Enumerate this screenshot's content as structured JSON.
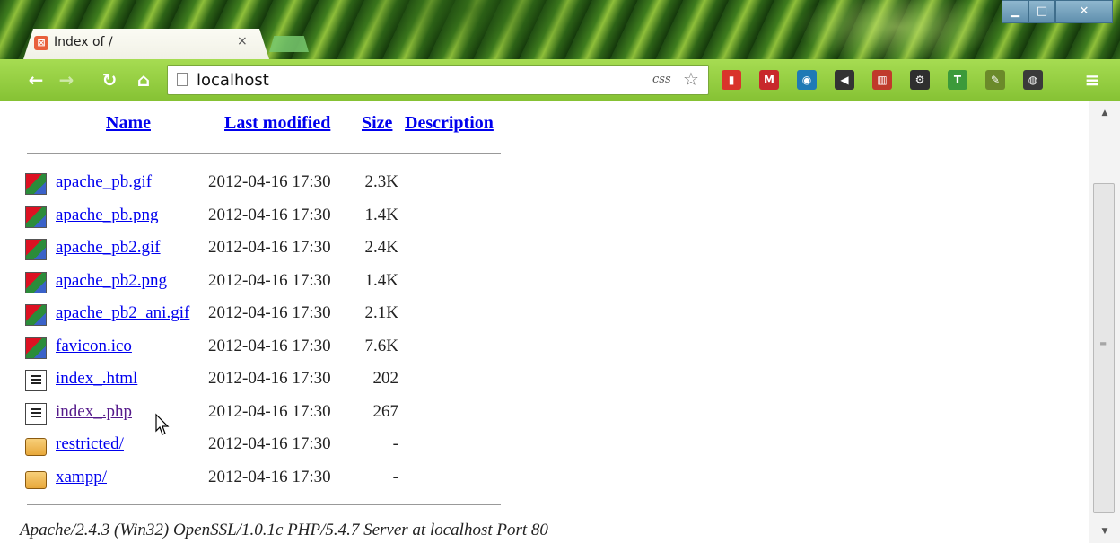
{
  "browser": {
    "tab": {
      "favicon": "xampp-favicon",
      "title": "Index of /",
      "close_label": "×"
    },
    "window_controls": {
      "minimize": "▁",
      "maximize": "□",
      "close": "✕"
    },
    "toolbar": {
      "back_icon": "back-arrow-icon",
      "forward_icon": "forward-arrow-icon",
      "reload_icon": "reload-icon",
      "home_icon": "home-icon",
      "url": "localhost",
      "css_indicator": "css",
      "star_glyph": "☆",
      "extensions": [
        {
          "name": "acrobat-extension-icon",
          "glyph": "▮",
          "color": "#d9342b"
        },
        {
          "name": "gmail-extension-icon",
          "glyph": "M",
          "color": "#c8282b"
        },
        {
          "name": "speaker-extension-icon",
          "glyph": "◉",
          "color": "#1f7ab5"
        },
        {
          "name": "volume-extension-icon",
          "glyph": "◀",
          "color": "#333333"
        },
        {
          "name": "books-extension-icon",
          "glyph": "▥",
          "color": "#c03a2b"
        },
        {
          "name": "settings-extension-icon",
          "glyph": "⚙",
          "color": "#2f2f2f"
        },
        {
          "name": "t-extension-icon",
          "glyph": "T",
          "color": "#3c9a3a"
        },
        {
          "name": "eyedropper-extension-icon",
          "glyph": "✎",
          "color": "#6b8a2a"
        },
        {
          "name": "evernote-extension-icon",
          "glyph": "◍",
          "color": "#3a3a3a"
        }
      ],
      "menu_glyph": "≡"
    }
  },
  "listing": {
    "headers": {
      "name": "Name",
      "last_modified": "Last modified",
      "size": "Size",
      "description": "Description"
    },
    "rows": [
      {
        "name": "apache_pb.gif",
        "date": "2012-04-16 17:30",
        "size": "2.3K",
        "icon": "image-file-icon"
      },
      {
        "name": "apache_pb.png",
        "date": "2012-04-16 17:30",
        "size": "1.4K",
        "icon": "image-file-icon"
      },
      {
        "name": "apache_pb2.gif",
        "date": "2012-04-16 17:30",
        "size": "2.4K",
        "icon": "image-file-icon"
      },
      {
        "name": "apache_pb2.png",
        "date": "2012-04-16 17:30",
        "size": "1.4K",
        "icon": "image-file-icon"
      },
      {
        "name": "apache_pb2_ani.gif",
        "date": "2012-04-16 17:30",
        "size": "2.1K",
        "icon": "image-file-icon"
      },
      {
        "name": "favicon.ico",
        "date": "2012-04-16 17:30",
        "size": "7.6K",
        "icon": "image-file-icon"
      },
      {
        "name": "index_.html",
        "date": "2012-04-16 17:30",
        "size": "202",
        "icon": "text-file-icon"
      },
      {
        "name": "index_.php",
        "date": "2012-04-16 17:30",
        "size": "267",
        "icon": "text-file-icon"
      },
      {
        "name": "restricted/",
        "date": "2012-04-16 17:30",
        "size": "-",
        "icon": "folder-icon"
      },
      {
        "name": "xampp/",
        "date": "2012-04-16 17:30",
        "size": "-",
        "icon": "folder-icon"
      }
    ],
    "server_signature": "Apache/2.4.3 (Win32) OpenSSL/1.0.1c PHP/5.4.7 Server at localhost Port 80"
  },
  "scrollbar": {
    "up_glyph": "▲",
    "down_glyph": "▼",
    "grip_glyph": "≡"
  }
}
